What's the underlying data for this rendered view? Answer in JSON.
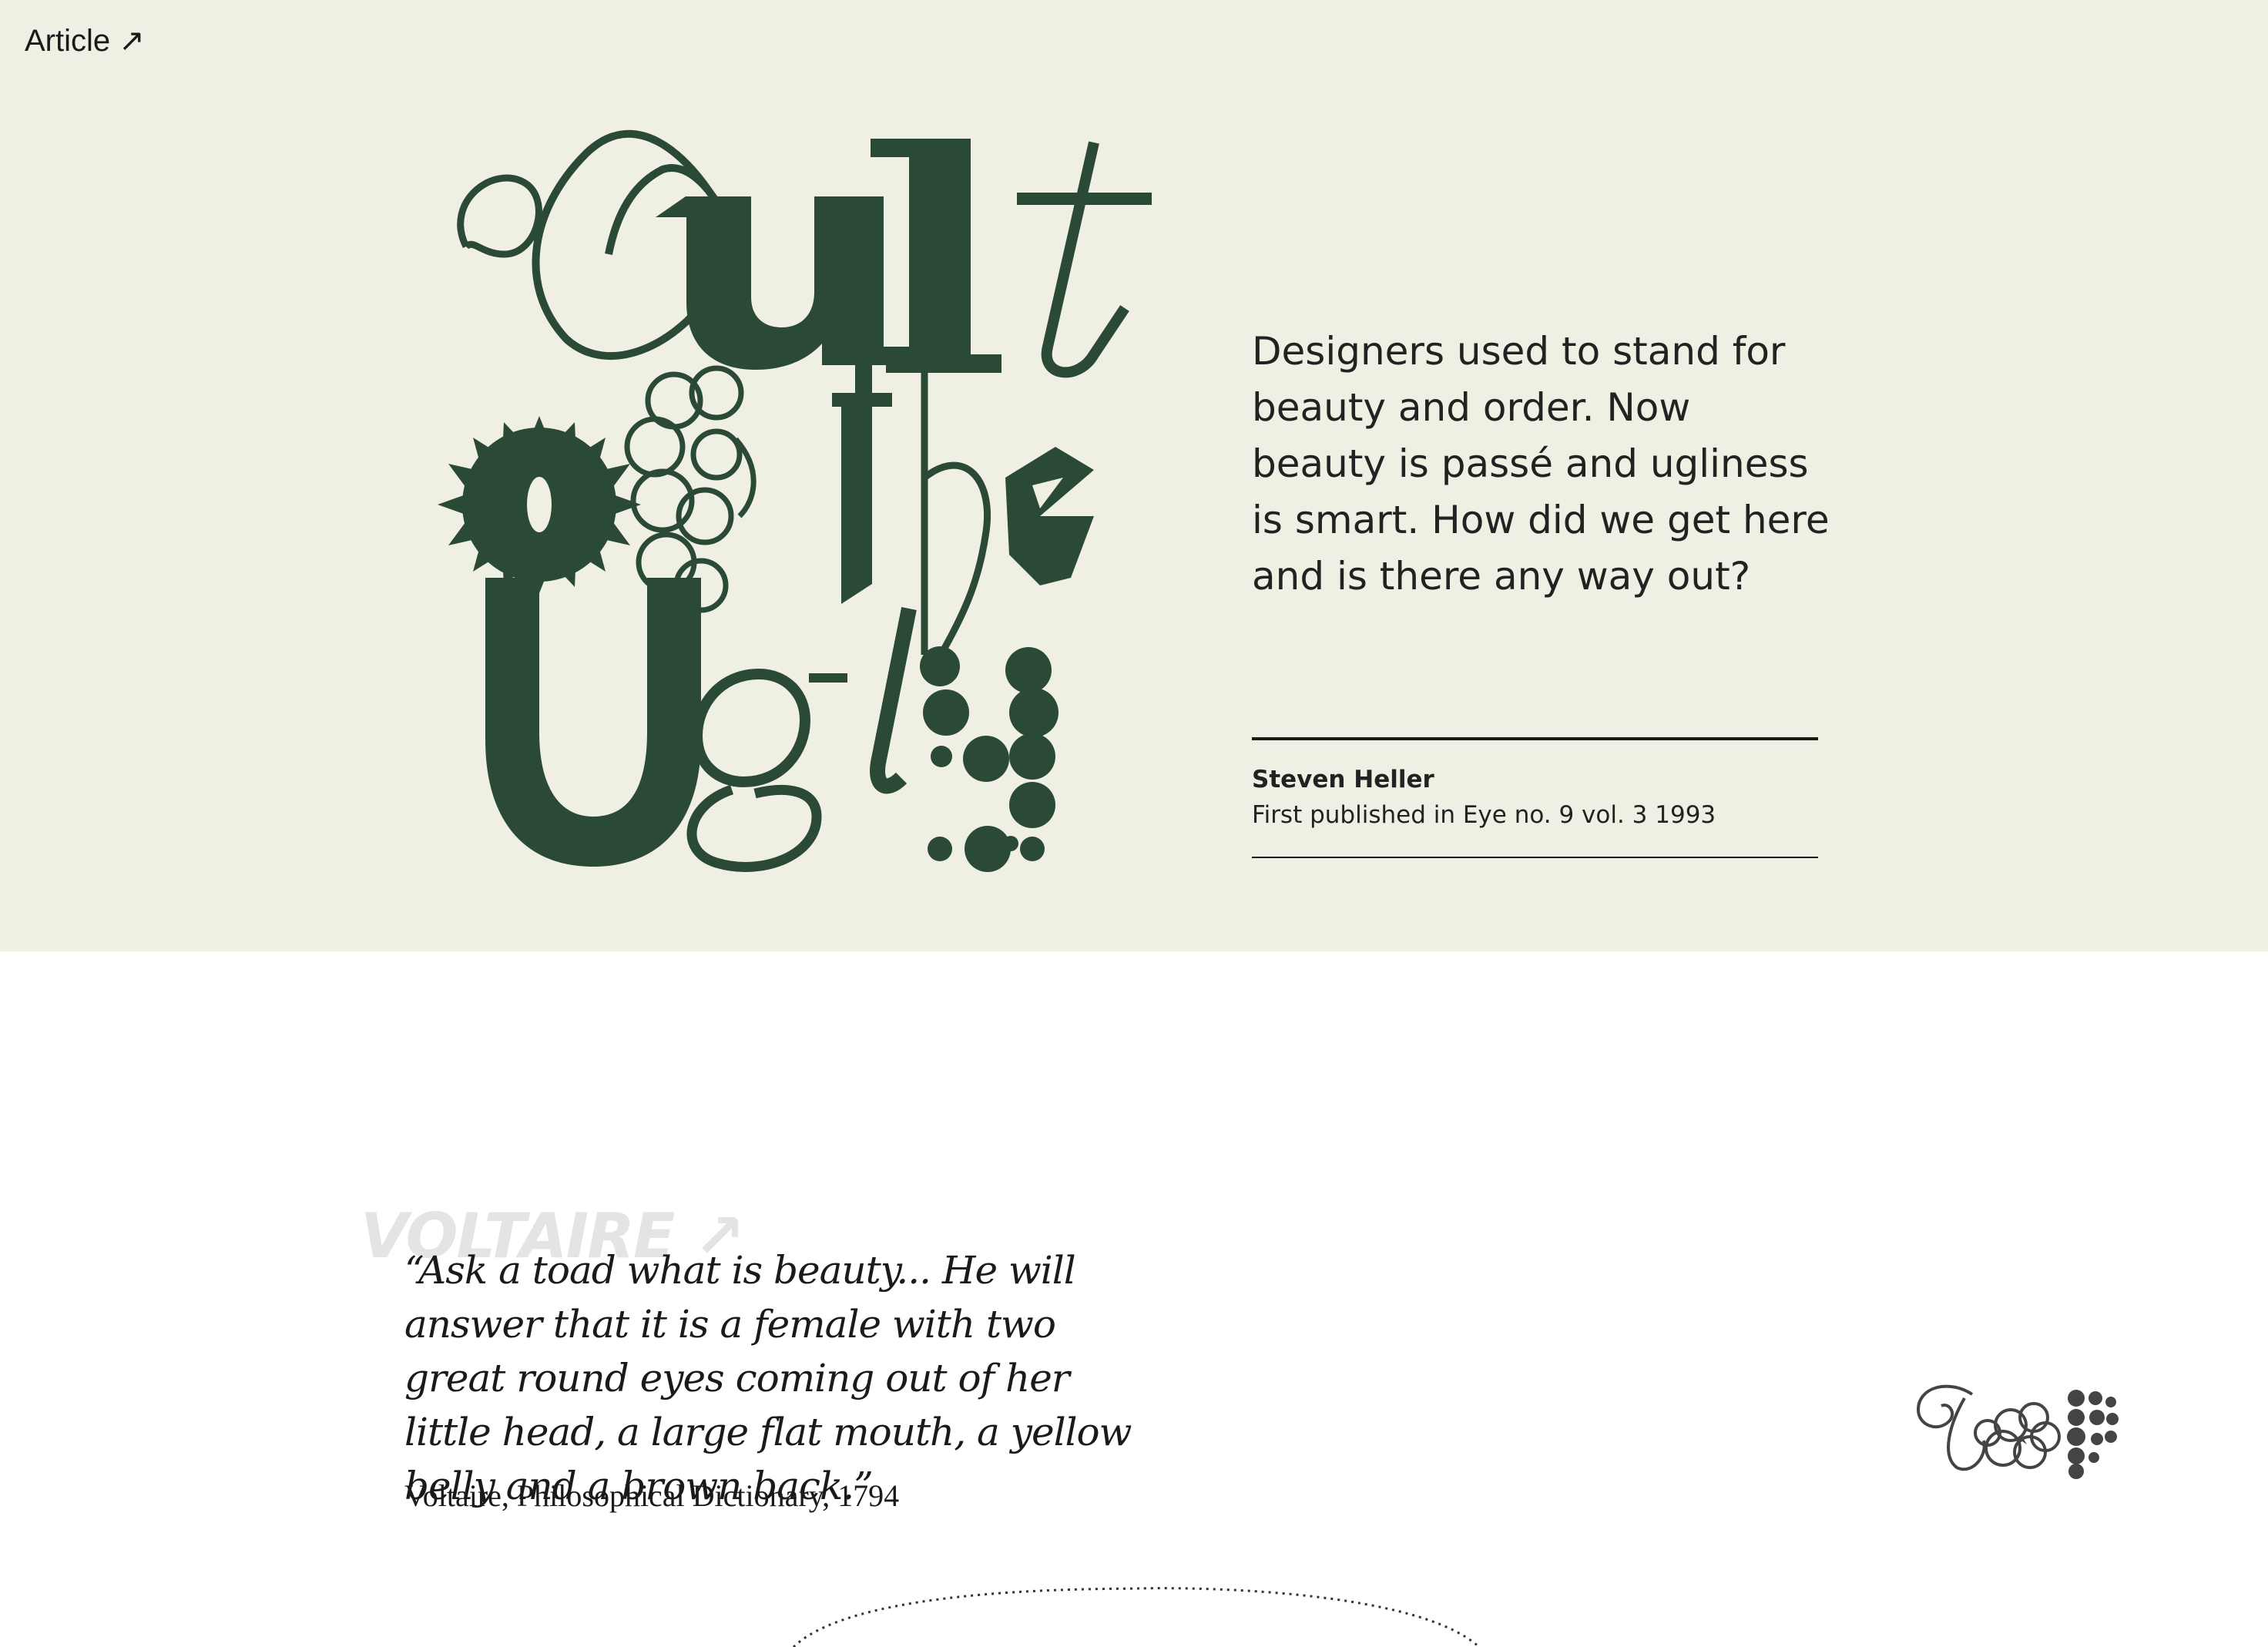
{
  "nav": {
    "article_link": "Article ↗"
  },
  "hero": {
    "title_art_text": "Cult of the Ugly",
    "intro": "Designers used to stand for beauty and order. Now beauty is passé and ugliness is smart. How did we get here and is there any way out?",
    "author": "Steven Heller",
    "publication": "First published in Eye no. 9 vol. 3 1993",
    "colors": {
      "background": "#f0efe3",
      "accent_green": "#2b4a36"
    }
  },
  "quote_section": {
    "ghost_link": "VOLTAIRE ↗",
    "quote": "“Ask a toad what is beauty... He will answer that it is a female with two great round eyes coming out of her little head, a large flat mouth, a yellow belly and a brown back.”",
    "source": "Voltaire, Philosophical Dictionary, 1794"
  }
}
